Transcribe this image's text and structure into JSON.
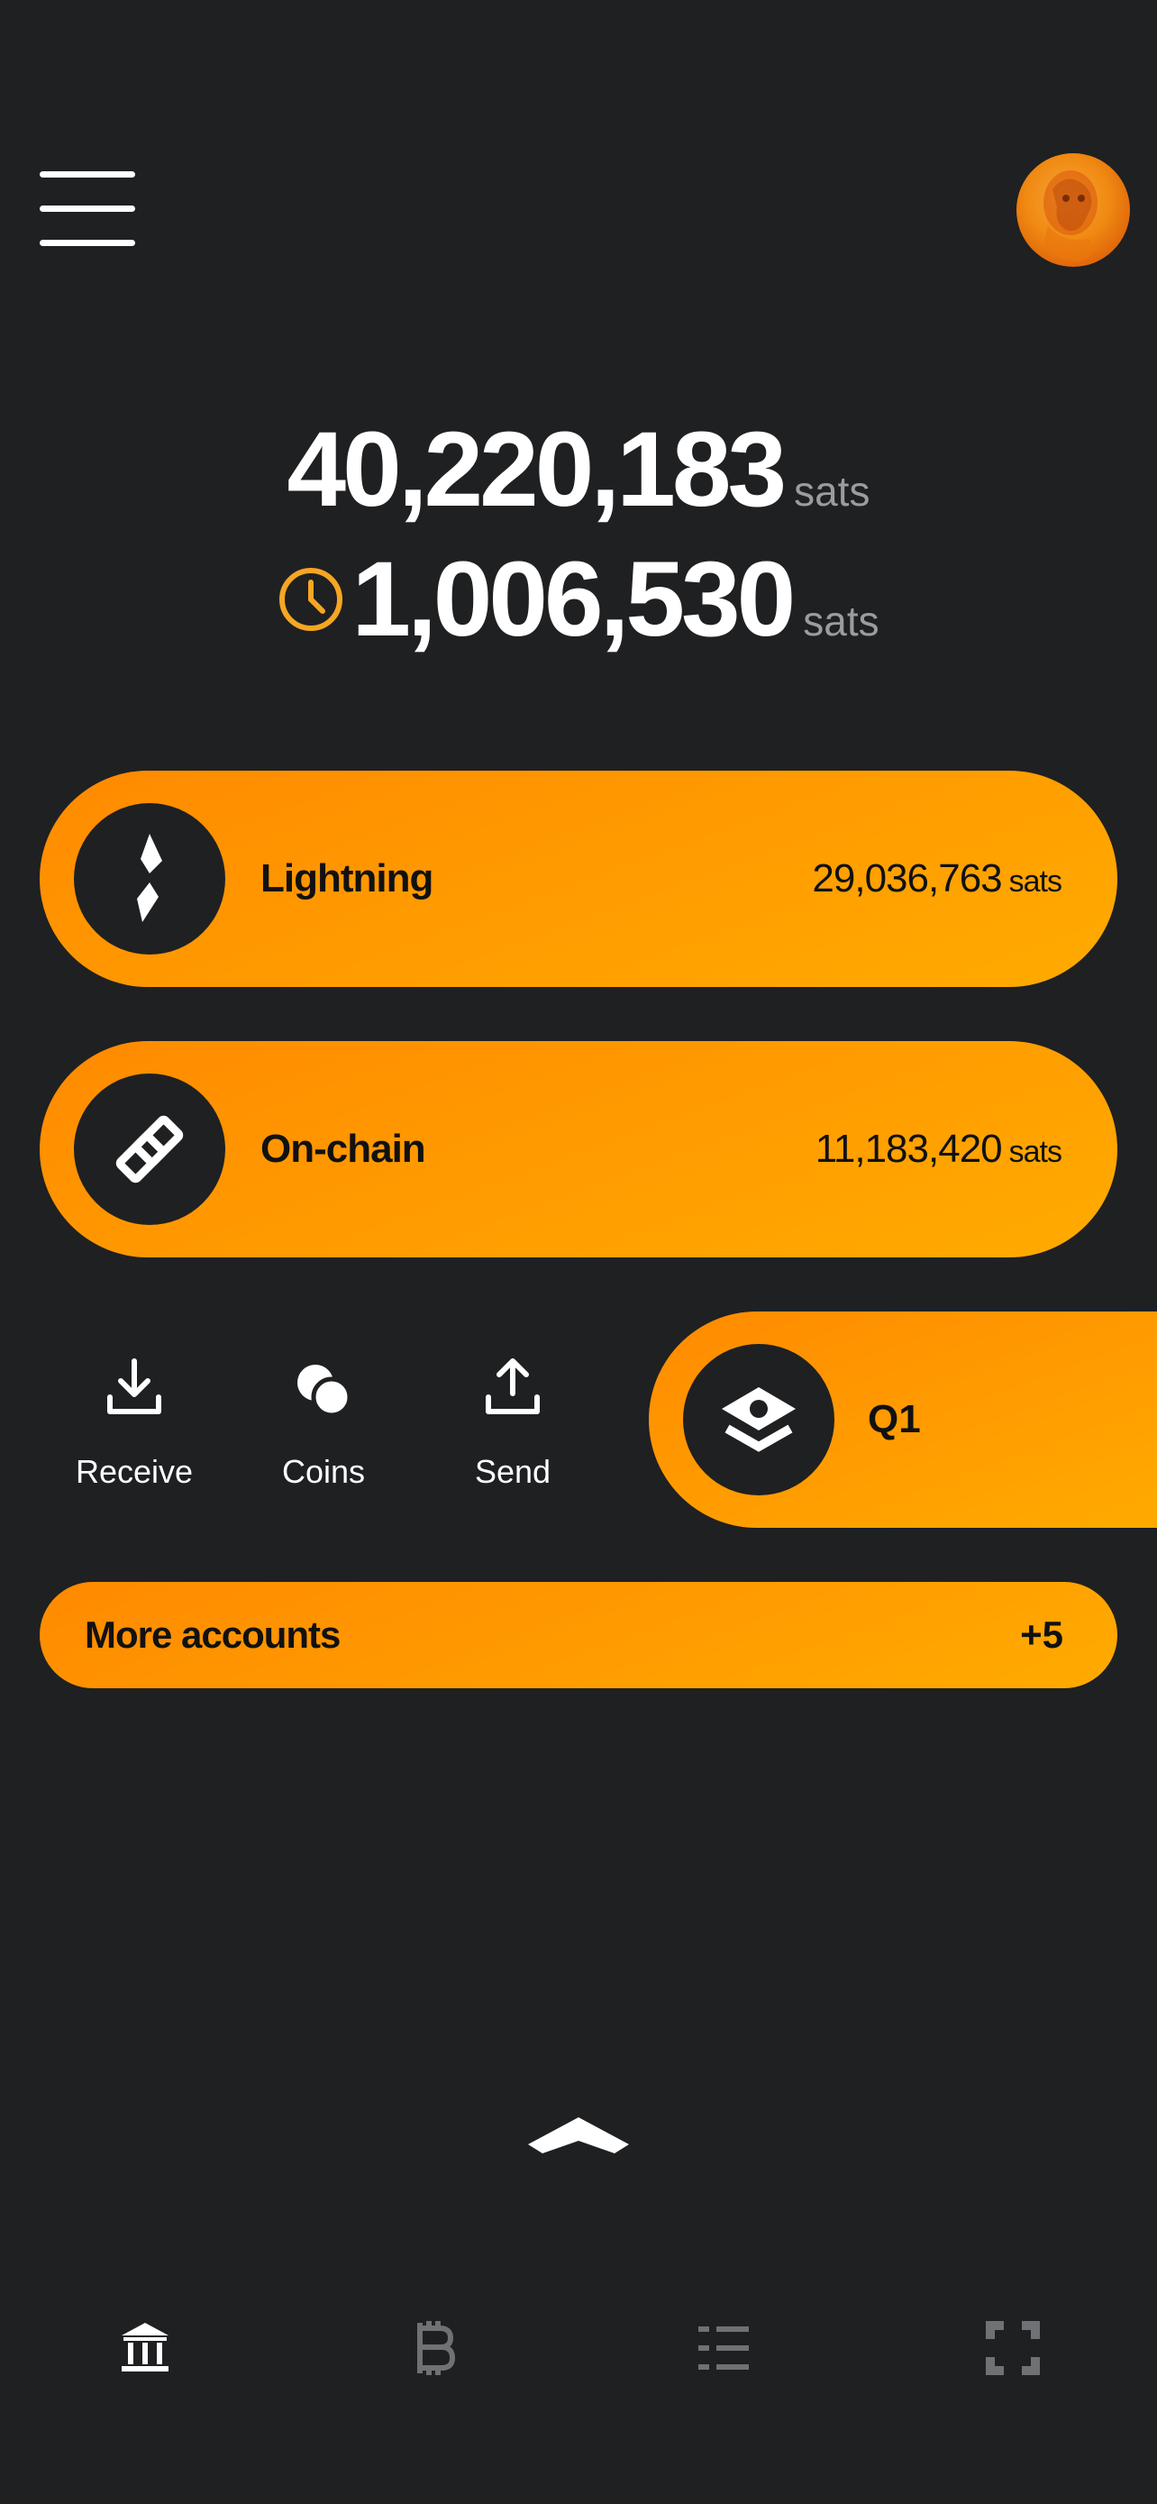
{
  "header": {
    "menu_icon": "hamburger-menu-icon",
    "avatar_icon": "profile-avatar"
  },
  "balance": {
    "total_value": "40,220,183",
    "total_unit": "sats",
    "pending_icon": "clock-icon",
    "pending_value": "1,006,530",
    "pending_unit": "sats"
  },
  "accounts": [
    {
      "icon": "lightning-icon",
      "name": "Lightning",
      "amount": "29,036,763",
      "unit": "sats"
    },
    {
      "icon": "chain-link-icon",
      "name": "On-chain",
      "amount": "11,183,420",
      "unit": "sats"
    }
  ],
  "actions": [
    {
      "icon": "receive-icon",
      "label": "Receive"
    },
    {
      "icon": "coins-icon",
      "label": "Coins"
    },
    {
      "icon": "send-icon",
      "label": "Send"
    }
  ],
  "partial_account": {
    "icon": "eye-shield-icon",
    "name": "Q1"
  },
  "more_accounts": {
    "label": "More accounts",
    "count": "+5"
  },
  "expand_icon": "chevron-up-icon",
  "bottom_nav": [
    {
      "icon": "bank-icon",
      "active": true
    },
    {
      "icon": "bitcoin-icon",
      "active": false
    },
    {
      "icon": "list-icon",
      "active": false
    },
    {
      "icon": "scan-icon",
      "active": false
    }
  ],
  "colors": {
    "background": "#1f2022",
    "accent": "#ff9800",
    "pending": "#f5a623",
    "muted": "#9a9ca0"
  }
}
